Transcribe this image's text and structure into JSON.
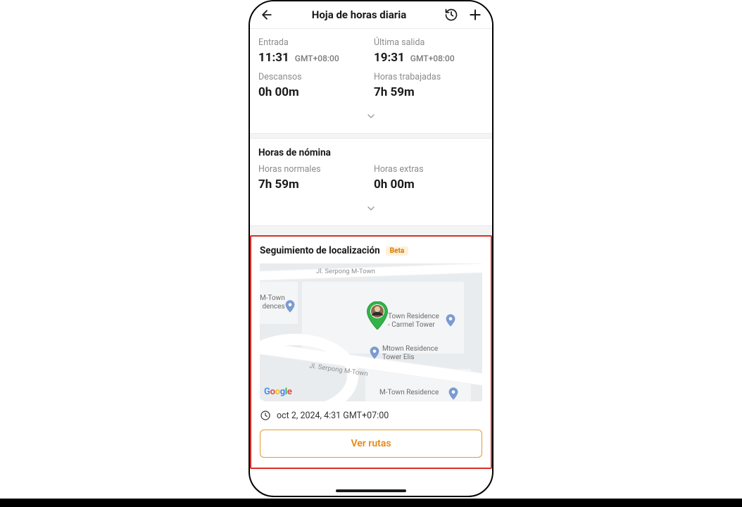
{
  "header": {
    "title": "Hoja de horas diaria"
  },
  "summary": {
    "entry": {
      "label": "Entrada",
      "time": "11:31",
      "tz": "GMT+08:00"
    },
    "exit": {
      "label": "Última salida",
      "time": "19:31",
      "tz": "GMT+08:00"
    },
    "breaks": {
      "label": "Descansos",
      "value": "0h 00m"
    },
    "worked": {
      "label": "Horas trabajadas",
      "value": "7h 59m"
    }
  },
  "payroll": {
    "title": "Horas de nómina",
    "regular": {
      "label": "Horas normales",
      "value": "7h 59m"
    },
    "extra": {
      "label": "Horas extras",
      "value": "0h 00m"
    }
  },
  "location": {
    "title": "Seguimiento de localización",
    "badge": "Beta",
    "map_labels": {
      "road1": "Jl. Serpong M-Town",
      "road2": "Jl. Serpong M-Town",
      "place1_line1": "M-Town",
      "place1_line2": "dences",
      "place2_line1": "Town Residence",
      "place2_line2": "- Carmel Tower",
      "place3_line1": "Mtown Residence",
      "place3_line2": "Tower Elis",
      "place4_line1": "M-Town Residence"
    },
    "timestamp": "oct 2, 2024, 4:31 GMT+07:00",
    "cta": "Ver rutas"
  },
  "colors": {
    "accent": "#e48a15",
    "highlight_border": "#d93025",
    "pin_green": "#33b24a"
  }
}
